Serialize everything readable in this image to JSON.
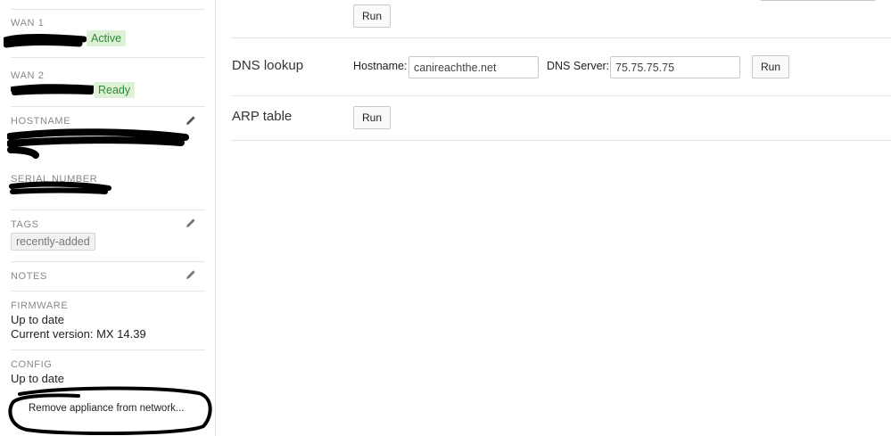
{
  "sidebar": {
    "wan1": {
      "label": "WAN 1",
      "status": "Active"
    },
    "wan2": {
      "label": "WAN 2",
      "status": "Ready"
    },
    "hostname": {
      "label": "HOSTNAME"
    },
    "serial": {
      "label": "SERIAL NUMBER"
    },
    "tags": {
      "label": "TAGS",
      "items": [
        "recently-added"
      ]
    },
    "notes": {
      "label": "NOTES"
    },
    "firmware": {
      "label": "FIRMWARE",
      "status": "Up to date",
      "version": "Current version: MX 14.39"
    },
    "config": {
      "label": "CONFIG",
      "status": "Up to date"
    },
    "remove_button": "Remove appliance from network..."
  },
  "tools": {
    "top": {
      "run_label": "Run"
    },
    "dns": {
      "title": "DNS lookup",
      "hostname_label": "Hostname:",
      "hostname_value": "canireachthe.net",
      "dns_server_label": "DNS Server:",
      "dns_server_value": "75.75.75.75",
      "run_label": "Run"
    },
    "arp": {
      "title": "ARP table",
      "run_label": "Run"
    }
  },
  "colors": {
    "status_green_bg": "#dcf1d6",
    "status_green_text": "#2e8b35",
    "redaction": "#000000"
  },
  "icons": {
    "edit": "pencil-icon"
  }
}
